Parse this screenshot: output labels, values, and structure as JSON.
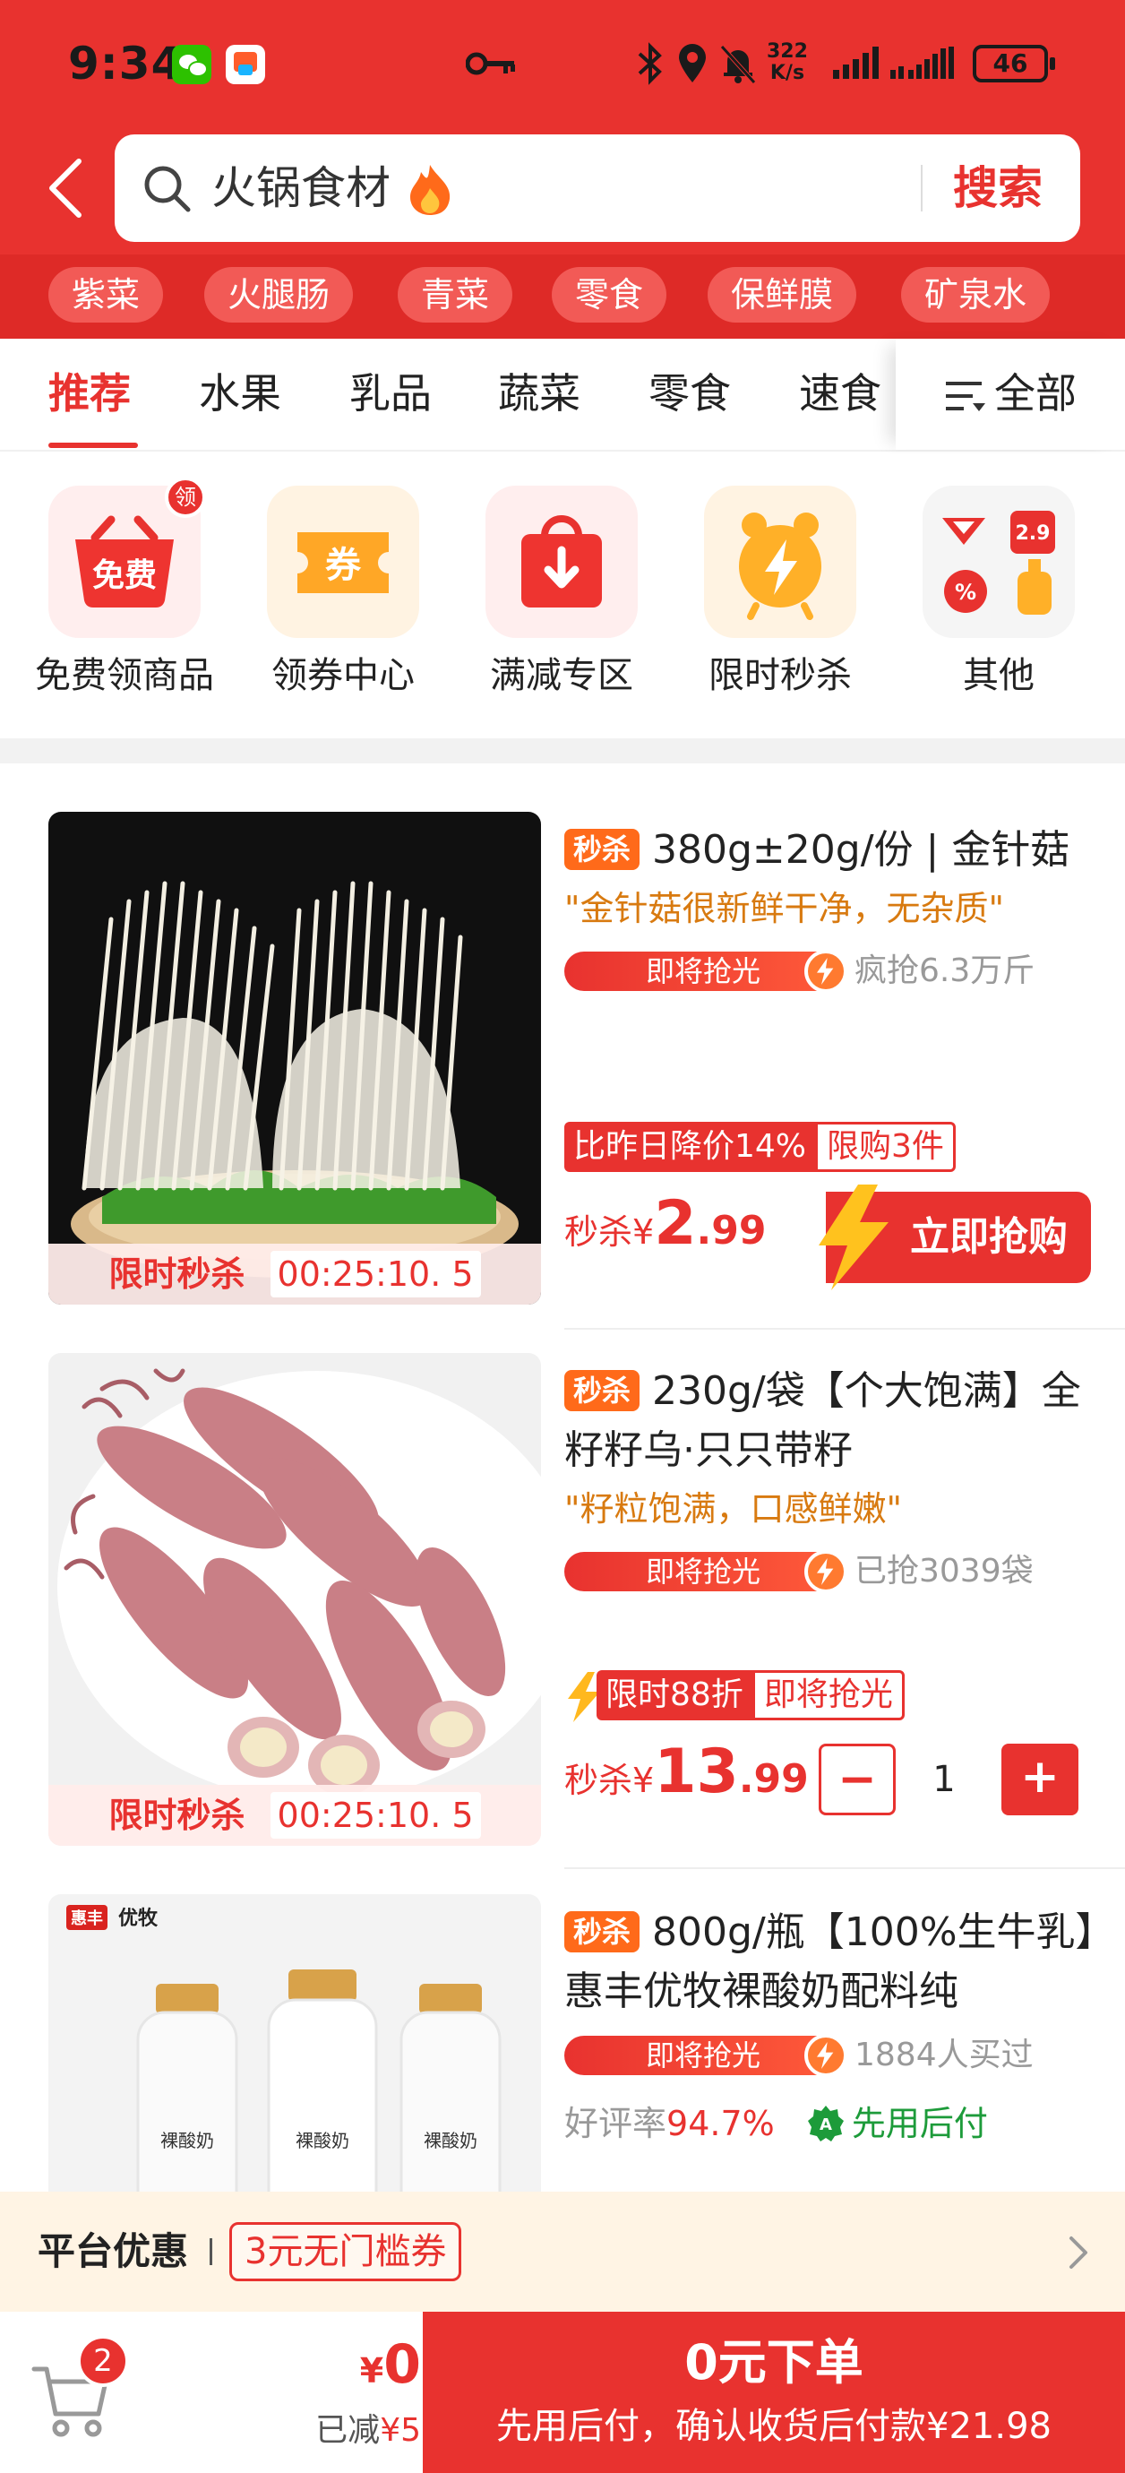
{
  "status_bar": {
    "time": "9:34",
    "net_speed_value": "322",
    "net_speed_unit": "K/s",
    "battery": "46"
  },
  "search": {
    "query": "火锅食材",
    "button_label": "搜索"
  },
  "quick_tags": [
    "紫菜",
    "火腿肠",
    "青菜",
    "零食",
    "保鲜膜",
    "矿泉水"
  ],
  "category_tabs": {
    "items": [
      "推荐",
      "水果",
      "乳品",
      "蔬菜",
      "零食",
      "速食"
    ],
    "active_index": 0,
    "all_label": "全部"
  },
  "quick_entries": [
    {
      "label": "免费领商品",
      "tile_text": "免费",
      "badge": "领",
      "icon": "free-basket-icon"
    },
    {
      "label": "领券中心",
      "tile_text": "券",
      "icon": "coupon-ticket-icon"
    },
    {
      "label": "满减专区",
      "icon": "discount-bag-icon"
    },
    {
      "label": "限时秒杀",
      "icon": "alarm-clock-icon"
    },
    {
      "label": "其他",
      "tile_price": "2.9",
      "icon": "more-categories-icon"
    }
  ],
  "products": [
    {
      "badge": "秒杀",
      "title": "380g±20g/份 | 金针菇",
      "quote": "\"金针菇很新鲜干净，无杂质\"",
      "hot_label": "即将抢光",
      "hot_stat": "疯抢6.3万斤",
      "promo_red": "比昨日降价14%",
      "promo_outline": "限购3件",
      "price_prefix": "秒杀¥",
      "price_int": "2",
      "price_dec": ".99",
      "buy_label": "立即抢购",
      "timer_label": "限时秒杀",
      "timer_value": "00:25:10. 5",
      "image": "enoki-mushroom-photo"
    },
    {
      "badge": "秒杀",
      "title": "230g/袋【个大饱满】全籽籽乌·只只带籽",
      "quote": "\"籽粒饱满，口感鲜嫩\"",
      "hot_label": "即将抢光",
      "hot_stat": "已抢3039袋",
      "promo_red": "限时88折",
      "promo_outline": "即将抢光",
      "price_prefix": "秒杀¥",
      "price_int": "13",
      "price_dec": ".99",
      "quantity": "1",
      "timer_label": "限时秒杀",
      "timer_value": "00:25:10. 5",
      "image": "squid-photo"
    },
    {
      "badge": "秒杀",
      "title": "800g/瓶【100%生牛乳】惠丰优牧裸酸奶配料纯",
      "hot_label": "即将抢光",
      "hot_stat": "1884人买过",
      "rating_label": "好评率",
      "rating_value": "94.7%",
      "pay_later": "先用后付",
      "brand_logo_text": "惠丰优牧",
      "bottle_label": "裸酸奶",
      "image": "yogurt-bottles-photo"
    }
  ],
  "platform": {
    "label": "平台优惠",
    "coupon": "3元无门槛券"
  },
  "bottom_bar": {
    "cart_count": "2",
    "currency": "¥",
    "total": "0",
    "saved_label": "已减",
    "saved_amount": "¥5",
    "order_title": "0元下单",
    "order_sub": "先用后付，确认收货后付款¥21.98"
  },
  "colors": {
    "brand_red": "#e8322f",
    "quote_orange": "#d87a10",
    "pay_green": "#1d9b3a",
    "platform_bg": "#fff4e4"
  }
}
